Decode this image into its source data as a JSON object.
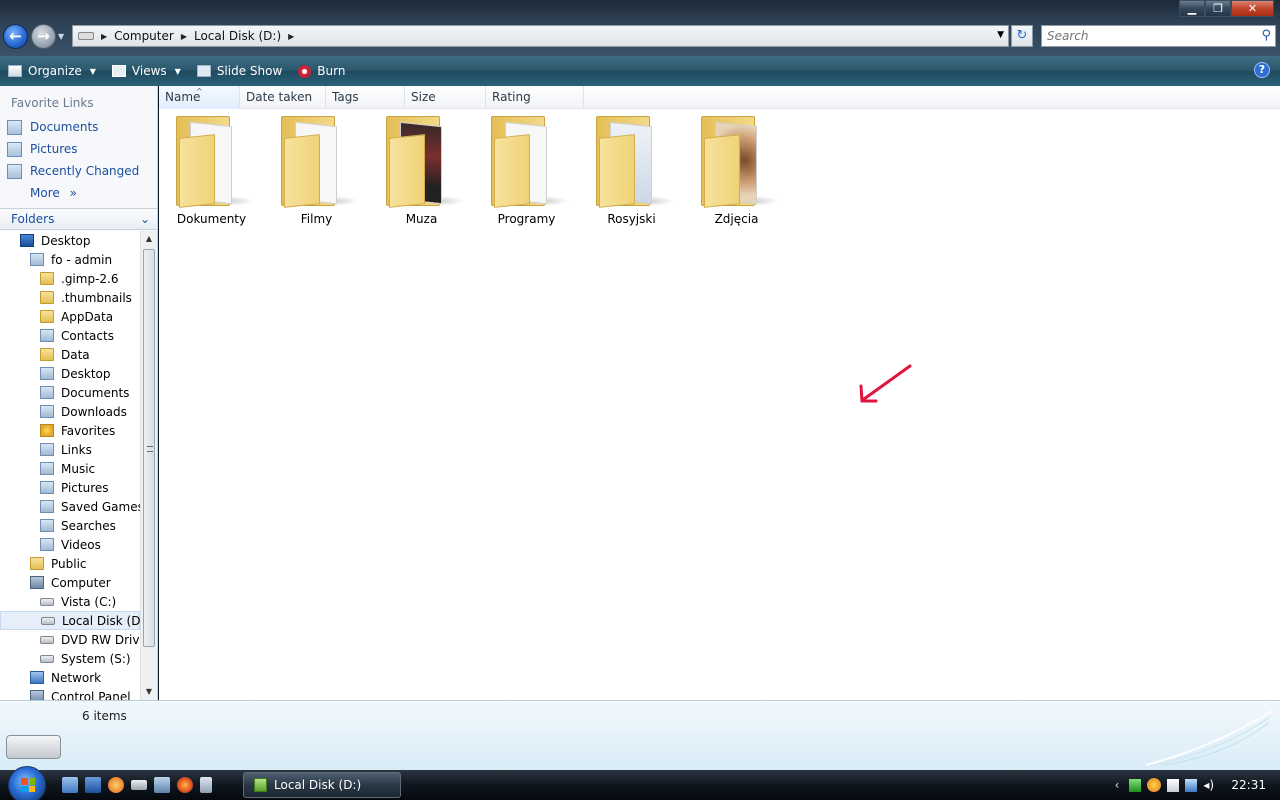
{
  "window": {
    "controls": {
      "minimize": "▁",
      "maximize": "❐",
      "close": "✕"
    }
  },
  "address_bar": {
    "crumbs": [
      "Computer",
      "Local Disk (D:)"
    ],
    "refresh_glyph": "↻"
  },
  "search": {
    "placeholder": "Search"
  },
  "toolbar": {
    "organize": "Organize",
    "views": "Views",
    "slideshow": "Slide Show",
    "burn": "Burn",
    "help": "?"
  },
  "nav": {
    "favorite_links_header": "Favorite Links",
    "favorites": [
      "Documents",
      "Pictures",
      "Recently Changed"
    ],
    "more": "More",
    "more_glyph": "»",
    "folders_header": "Folders"
  },
  "tree": [
    {
      "label": "Desktop",
      "indent": 0,
      "icon": "desktop"
    },
    {
      "label": "fo - admin",
      "indent": 1,
      "icon": "user"
    },
    {
      "label": ".gimp-2.6",
      "indent": 2,
      "icon": "folder"
    },
    {
      "label": ".thumbnails",
      "indent": 2,
      "icon": "folder"
    },
    {
      "label": "AppData",
      "indent": 2,
      "icon": "folder"
    },
    {
      "label": "Contacts",
      "indent": 2,
      "icon": "user"
    },
    {
      "label": "Data",
      "indent": 2,
      "icon": "folder"
    },
    {
      "label": "Desktop",
      "indent": 2,
      "icon": "user"
    },
    {
      "label": "Documents",
      "indent": 2,
      "icon": "user"
    },
    {
      "label": "Downloads",
      "indent": 2,
      "icon": "user"
    },
    {
      "label": "Favorites",
      "indent": 2,
      "icon": "star"
    },
    {
      "label": "Links",
      "indent": 2,
      "icon": "user"
    },
    {
      "label": "Music",
      "indent": 2,
      "icon": "user"
    },
    {
      "label": "Pictures",
      "indent": 2,
      "icon": "user"
    },
    {
      "label": "Saved Games",
      "indent": 2,
      "icon": "user"
    },
    {
      "label": "Searches",
      "indent": 2,
      "icon": "user"
    },
    {
      "label": "Videos",
      "indent": 2,
      "icon": "user"
    },
    {
      "label": "Public",
      "indent": 1,
      "icon": "folder"
    },
    {
      "label": "Computer",
      "indent": 1,
      "icon": "computer"
    },
    {
      "label": "Vista (C:)",
      "indent": 2,
      "icon": "drive"
    },
    {
      "label": "Local Disk (D:)",
      "indent": 2,
      "icon": "drive",
      "selected": true
    },
    {
      "label": "DVD RW Drive",
      "indent": 2,
      "icon": "drive"
    },
    {
      "label": "System (S:)",
      "indent": 2,
      "icon": "drive"
    },
    {
      "label": "Network",
      "indent": 1,
      "icon": "network"
    },
    {
      "label": "Control Panel",
      "indent": 1,
      "icon": "computer"
    }
  ],
  "columns": [
    "Name",
    "Date taken",
    "Tags",
    "Size",
    "Rating"
  ],
  "sort_glyph": "^",
  "items": [
    {
      "label": "Dokumenty",
      "thumb": "plain"
    },
    {
      "label": "Filmy",
      "thumb": "plain"
    },
    {
      "label": "Muza",
      "thumb": "dark"
    },
    {
      "label": "Programy",
      "thumb": "plain"
    },
    {
      "label": "Rosyjski",
      "thumb": "blue"
    },
    {
      "label": "Zdjęcia",
      "thumb": "photo"
    }
  ],
  "details": {
    "item_count": "6 items"
  },
  "annotation": {
    "arrow_color": "#e0143c"
  },
  "taskbar": {
    "active_window": "Local Disk (D:)",
    "tray_chevron": "‹",
    "clock": "22:31"
  }
}
